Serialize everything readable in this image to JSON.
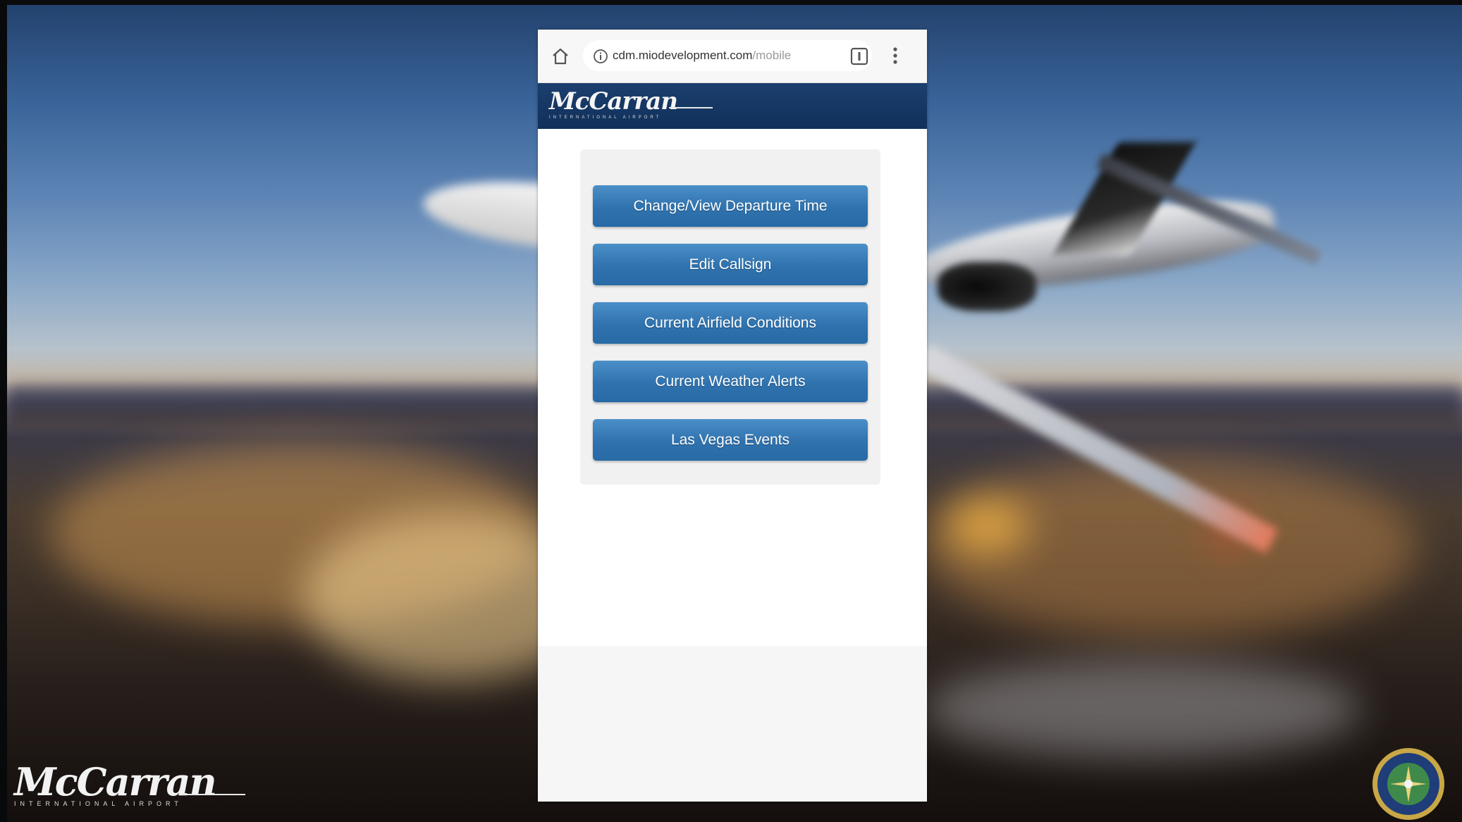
{
  "browser": {
    "url_host": "cdm.miodevelopment.com",
    "url_path": "/mobile"
  },
  "site": {
    "logo_text": "McCarran",
    "logo_subtext": "INTERNATIONAL AIRPORT"
  },
  "menu": {
    "items": [
      {
        "label": "Change/View Departure Time"
      },
      {
        "label": "Edit Callsign"
      },
      {
        "label": "Current Airfield Conditions"
      },
      {
        "label": "Current Weather Alerts"
      },
      {
        "label": "Las Vegas Events"
      }
    ]
  },
  "background": {
    "logo_text": "McCarran",
    "logo_subtext": "INTERNATIONAL AIRPORT"
  },
  "colors": {
    "header": "#163865",
    "button": "#3a7fbd"
  }
}
